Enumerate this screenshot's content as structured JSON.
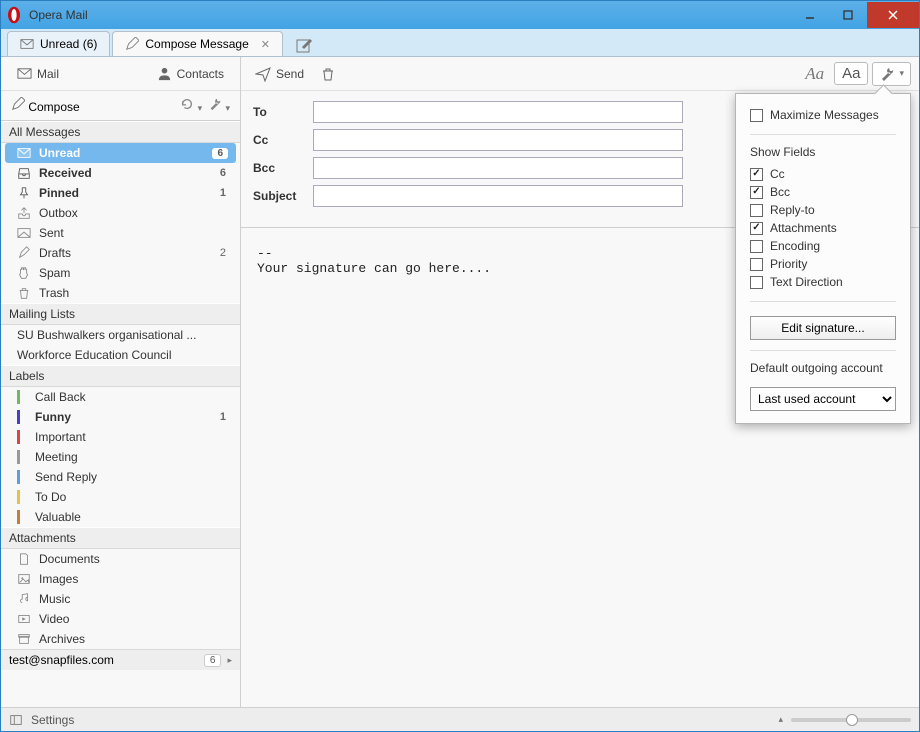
{
  "window": {
    "title": "Opera Mail"
  },
  "tabs": {
    "unread": "Unread (6)",
    "compose": "Compose Message"
  },
  "sidebar": {
    "mail": "Mail",
    "contacts": "Contacts",
    "compose": "Compose",
    "section_all": "All Messages",
    "folders": {
      "unread": {
        "label": "Unread",
        "count": "6"
      },
      "received": {
        "label": "Received",
        "count": "6"
      },
      "pinned": {
        "label": "Pinned",
        "count": "1"
      },
      "outbox": {
        "label": "Outbox"
      },
      "sent": {
        "label": "Sent"
      },
      "drafts": {
        "label": "Drafts",
        "count": "2"
      },
      "spam": {
        "label": "Spam"
      },
      "trash": {
        "label": "Trash"
      }
    },
    "section_mailing": "Mailing Lists",
    "mailing": {
      "m1": "SU Bushwalkers organisational ...",
      "m2": "Workforce Education Council"
    },
    "section_labels": "Labels",
    "labels": {
      "callback": {
        "label": "Call Back",
        "color": "#6fb95e"
      },
      "funny": {
        "label": "Funny",
        "color": "#4a3fc4",
        "count": "1"
      },
      "important": {
        "label": "Important",
        "color": "#d44"
      },
      "meeting": {
        "label": "Meeting",
        "color": "#999"
      },
      "sendreply": {
        "label": "Send Reply",
        "color": "#5aa0dd"
      },
      "todo": {
        "label": "To Do",
        "color": "#e6c14a"
      },
      "valuable": {
        "label": "Valuable",
        "color": "#c97c3a"
      }
    },
    "section_attachments": "Attachments",
    "attachments": {
      "documents": "Documents",
      "images": "Images",
      "music": "Music",
      "video": "Video",
      "archives": "Archives"
    },
    "account": {
      "email": "test@snapfiles.com",
      "count": "6"
    }
  },
  "compose": {
    "send": "Send",
    "to": "To",
    "cc": "Cc",
    "bcc": "Bcc",
    "subject": "Subject",
    "body": "--\nYour signature can go here....",
    "font_serif": "Aa",
    "font_sans": "Aa"
  },
  "dropdown": {
    "maximize": "Maximize Messages",
    "show_fields": "Show Fields",
    "f_cc": "Cc",
    "f_bcc": "Bcc",
    "f_replyto": "Reply-to",
    "f_attachments": "Attachments",
    "f_encoding": "Encoding",
    "f_priority": "Priority",
    "f_textdir": "Text Direction",
    "edit_sig": "Edit signature...",
    "default_account_label": "Default outgoing account",
    "default_account_value": "Last used account"
  },
  "statusbar": {
    "settings": "Settings"
  }
}
